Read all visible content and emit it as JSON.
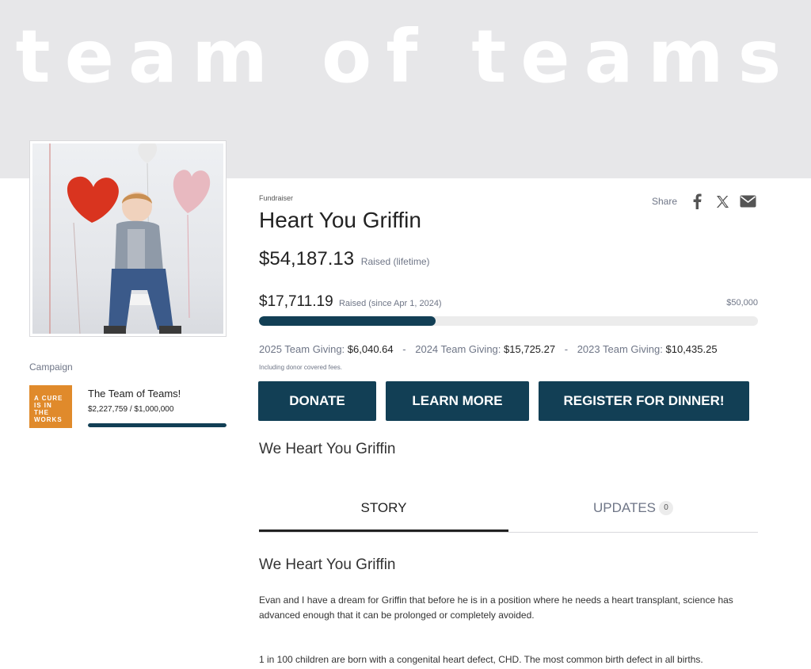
{
  "banner": {
    "title": "team of teams"
  },
  "fundraiser": {
    "eyebrow": "Fundraiser",
    "title": "Heart You Griffin",
    "raised_total": "$54,187.13",
    "raised_total_label": "Raised (lifetime)",
    "raised_period": "$17,711.19",
    "raised_period_label": "Raised (since Apr 1, 2024)",
    "goal": "$50,000",
    "progress_fraction": 0.354,
    "fees_note": "Including donor covered fees.",
    "subtitle": "We Heart You Griffin"
  },
  "giving": [
    {
      "label": "2025 Team Giving:",
      "value": "$6,040.64"
    },
    {
      "label": "2024 Team Giving:",
      "value": "$15,725.27"
    },
    {
      "label": "2023 Team Giving:",
      "value": "$10,435.25"
    }
  ],
  "share": {
    "label": "Share",
    "icons": [
      "facebook-icon",
      "x-icon",
      "email-icon"
    ]
  },
  "buttons": {
    "donate": "DONATE",
    "learn_more": "LEARN MORE",
    "register": "REGISTER FOR DINNER!"
  },
  "campaign": {
    "label": "Campaign",
    "logo_text": "A CURE IS IN THE WORKS",
    "name": "The Team of Teams!",
    "amount": "$2,227,759 / $1,000,000",
    "progress_fraction": 1.0
  },
  "tabs": {
    "story": "STORY",
    "updates": "UPDATES",
    "updates_count": "0"
  },
  "story": {
    "heading": "We Heart You Griffin",
    "paragraphs": [
      "Evan and I have a dream for Griffin that before he is in a position where he needs a heart transplant, science has advanced enough that it can be prolonged or completely avoided.",
      "1 in 100 children are born with a congenital heart defect, CHD. The most common birth defect in all births."
    ]
  },
  "colors": {
    "brand": "#123f55",
    "banner_bg": "#e7e7e9",
    "campaign_logo": "#e08a2b",
    "balloon_red": "#d9341f",
    "balloon_pink": "#e8b9c0"
  }
}
